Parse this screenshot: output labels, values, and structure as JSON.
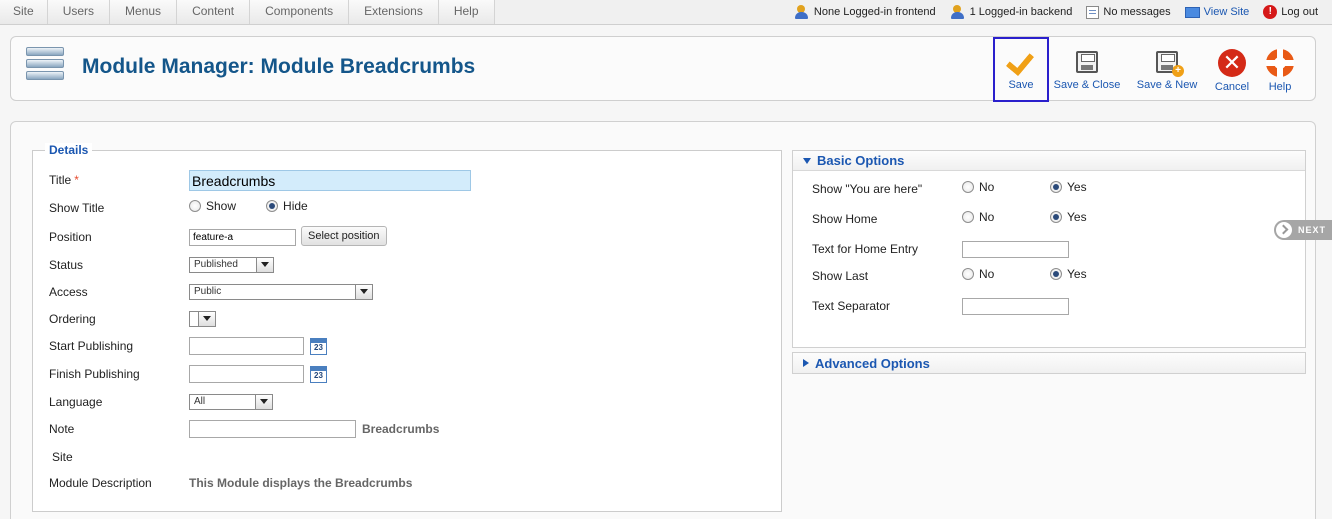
{
  "menu": {
    "items": [
      "Site",
      "Users",
      "Menus",
      "Content",
      "Components",
      "Extensions",
      "Help"
    ]
  },
  "status": {
    "frontend": "None Logged-in frontend",
    "backend": "1 Logged-in backend",
    "messages": "No messages",
    "view_site": "View Site",
    "logout": "Log out"
  },
  "header": {
    "title": "Module Manager: Module Breadcrumbs",
    "toolbar": {
      "save": "Save",
      "save_close": "Save & Close",
      "save_new": "Save & New",
      "cancel": "Cancel",
      "help": "Help"
    }
  },
  "details": {
    "legend": "Details",
    "title_label": "Title",
    "required_mark": "*",
    "title_value": "Breadcrumbs",
    "show_title_label": "Show Title",
    "show_opt": "Show",
    "hide_opt": "Hide",
    "position_label": "Position",
    "position_value": "feature-a",
    "select_position": "Select position",
    "status_label": "Status",
    "status_value": "Published",
    "access_label": "Access",
    "access_value": "Public",
    "ordering_label": "Ordering",
    "ordering_value": "",
    "start_label": "Start Publishing",
    "finish_label": "Finish Publishing",
    "calendar_day": "23",
    "language_label": "Language",
    "language_value": "All",
    "note_label": "Note",
    "note_suffix": "Breadcrumbs",
    "site_label": "Site",
    "description_label": "Module Description",
    "description_value": "This Module displays the Breadcrumbs"
  },
  "basic_options": {
    "title": "Basic Options",
    "no": "No",
    "yes": "Yes",
    "show_here_label": "Show \"You are here\"",
    "show_home_label": "Show Home",
    "home_text_label": "Text for Home Entry",
    "show_last_label": "Show Last",
    "separator_label": "Text Separator"
  },
  "advanced_options": {
    "title": "Advanced Options"
  },
  "next_tab": "NEXT",
  "colors": {
    "accent": "#1b57b1",
    "title": "#14568a",
    "save_highlight": "#2a1fcc"
  }
}
